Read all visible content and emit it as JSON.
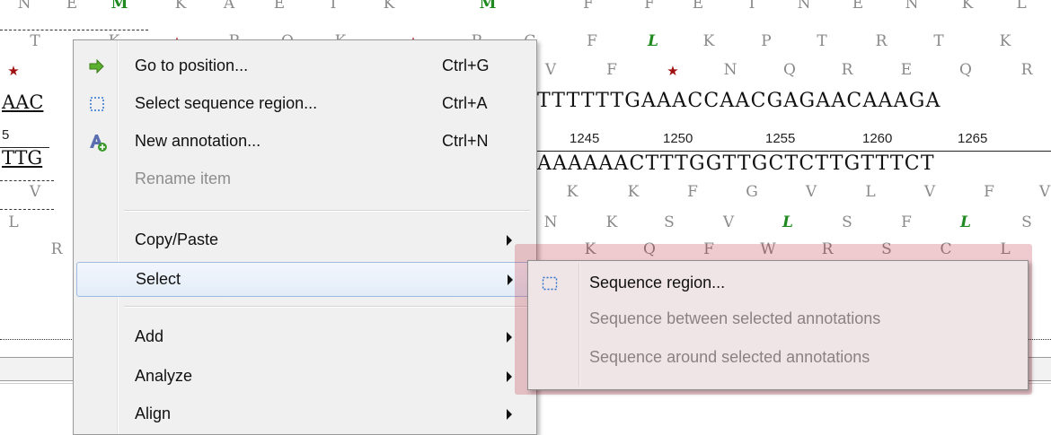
{
  "sequence_view": {
    "top_aa_row": [
      "N",
      "E",
      "M",
      "K",
      "A",
      "E",
      "I",
      "K",
      "M",
      "F",
      "F",
      "E",
      "I",
      "N",
      "E",
      "N",
      "K",
      "L"
    ],
    "frame_row_2": [
      "F",
      "L",
      "K",
      "P",
      "T",
      "R",
      "T",
      "K"
    ],
    "frame_row_2_left": [
      "T",
      "K",
      "R",
      "Q",
      "K",
      "R",
      "G"
    ],
    "frame_row_3": [
      "V",
      "F",
      "*",
      "N",
      "Q",
      "R",
      "E",
      "Q",
      "R"
    ],
    "dna_top": "TTTTTTGAAACCAACGAGAACAAAGA",
    "dna_top_left": "AAC",
    "ruler_numbers": [
      "1245",
      "1250",
      "1255",
      "1260",
      "1265"
    ],
    "ruler_left": "5",
    "dna_bottom": "AAAAAACTTTGGTTGCTCTTGTTTCT",
    "dna_bottom_left": "TTG",
    "rev_row_1": [
      "K",
      "K",
      "F",
      "G",
      "V",
      "L",
      "V",
      "F",
      "V"
    ],
    "rev_row_1_left": "V",
    "rev_row_2": [
      "N",
      "K",
      "S",
      "V",
      "L",
      "S",
      "F",
      "L",
      "S"
    ],
    "rev_row_2_left": "L",
    "rev_row_3": [
      "K",
      "Q",
      "F",
      "W",
      "R",
      "S",
      "C",
      "L"
    ],
    "rev_row_3_left": "R"
  },
  "context_menu": {
    "items": [
      {
        "label": "Go to position...",
        "shortcut": "Ctrl+G",
        "icon": "arrow-right-icon"
      },
      {
        "label": "Select sequence region...",
        "shortcut": "Ctrl+A",
        "icon": "dashed-selection-icon"
      },
      {
        "label": "New annotation...",
        "shortcut": "Ctrl+N",
        "icon": "new-annotation-icon"
      },
      {
        "label": "Rename item",
        "shortcut": "",
        "disabled": true
      },
      {
        "label": "Copy/Paste",
        "submenu": true
      },
      {
        "label": "Select",
        "submenu": true,
        "hover": true
      },
      {
        "label": "Add",
        "submenu": true
      },
      {
        "label": "Analyze",
        "submenu": true
      },
      {
        "label": "Align",
        "submenu": true
      }
    ]
  },
  "select_submenu": {
    "items": [
      {
        "label": "Sequence region...",
        "icon": "dashed-selection-icon"
      },
      {
        "label": "Sequence between selected annotations",
        "disabled": true
      },
      {
        "label": "Sequence around selected annotations",
        "disabled": true
      }
    ]
  },
  "colors": {
    "menu_bg": "#f0f0f0",
    "hover_border": "#9fbce0",
    "submenu_tint": "#efe4e6",
    "highlight_overlay": "rgba(180,20,40,0.22)",
    "amino_green": "#1f8a1f",
    "stop_red": "#a01010"
  }
}
